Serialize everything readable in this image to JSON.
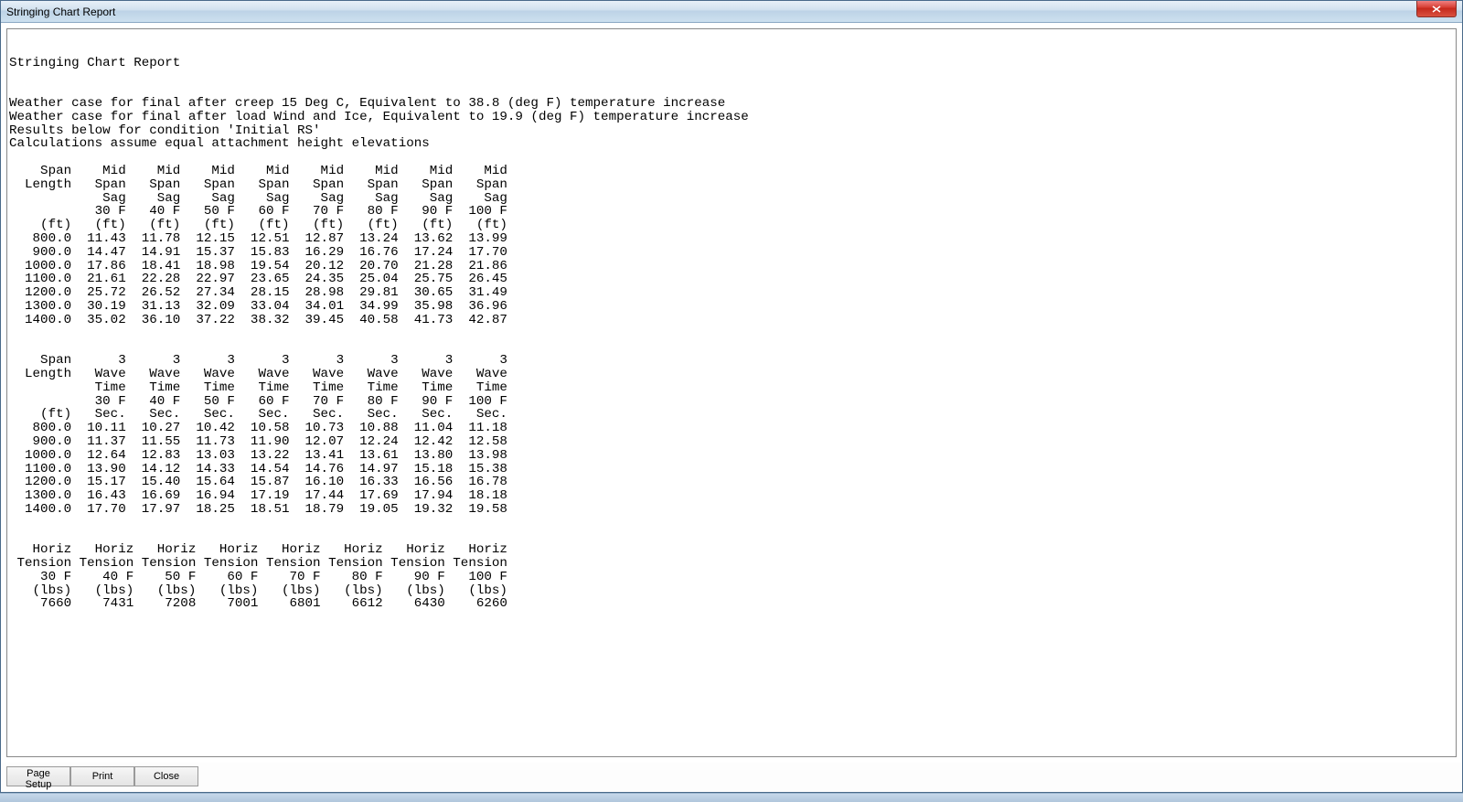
{
  "window": {
    "title": "Stringing Chart Report"
  },
  "buttons": {
    "page_setup": "Page Setup",
    "print": "Print",
    "close": "Close"
  },
  "report": {
    "title": "Stringing Chart Report",
    "notes": [
      "Weather case for final after creep 15 Deg C, Equivalent to 38.8 (deg F) temperature increase",
      "Weather case for final after load Wind and Ice, Equivalent to 19.9 (deg F) temperature increase",
      "Results below for condition 'Initial RS'",
      "Calculations assume equal attachment height elevations"
    ],
    "sag_table": {
      "header_lines": [
        "Span",
        "Length",
        "",
        "",
        "(ft)"
      ],
      "col_header_lines": [
        "Mid",
        "Span",
        "Sag"
      ],
      "temps": [
        "30 F",
        "40 F",
        "50 F",
        "60 F",
        "70 F",
        "80 F",
        "90 F",
        "100 F"
      ],
      "unit": "(ft)",
      "rows": [
        {
          "span": "800.0",
          "vals": [
            "11.43",
            "11.78",
            "12.15",
            "12.51",
            "12.87",
            "13.24",
            "13.62",
            "13.99"
          ]
        },
        {
          "span": "900.0",
          "vals": [
            "14.47",
            "14.91",
            "15.37",
            "15.83",
            "16.29",
            "16.76",
            "17.24",
            "17.70"
          ]
        },
        {
          "span": "1000.0",
          "vals": [
            "17.86",
            "18.41",
            "18.98",
            "19.54",
            "20.12",
            "20.70",
            "21.28",
            "21.86"
          ]
        },
        {
          "span": "1100.0",
          "vals": [
            "21.61",
            "22.28",
            "22.97",
            "23.65",
            "24.35",
            "25.04",
            "25.75",
            "26.45"
          ]
        },
        {
          "span": "1200.0",
          "vals": [
            "25.72",
            "26.52",
            "27.34",
            "28.15",
            "28.98",
            "29.81",
            "30.65",
            "31.49"
          ]
        },
        {
          "span": "1300.0",
          "vals": [
            "30.19",
            "31.13",
            "32.09",
            "33.04",
            "34.01",
            "34.99",
            "35.98",
            "36.96"
          ]
        },
        {
          "span": "1400.0",
          "vals": [
            "35.02",
            "36.10",
            "37.22",
            "38.32",
            "39.45",
            "40.58",
            "41.73",
            "42.87"
          ]
        }
      ]
    },
    "wave_table": {
      "header_lines": [
        "Span",
        "Length",
        "",
        "",
        "(ft)"
      ],
      "col_header_lines": [
        "3",
        "Wave",
        "Time"
      ],
      "temps": [
        "30 F",
        "40 F",
        "50 F",
        "60 F",
        "70 F",
        "80 F",
        "90 F",
        "100 F"
      ],
      "unit": "Sec.",
      "rows": [
        {
          "span": "800.0",
          "vals": [
            "10.11",
            "10.27",
            "10.42",
            "10.58",
            "10.73",
            "10.88",
            "11.04",
            "11.18"
          ]
        },
        {
          "span": "900.0",
          "vals": [
            "11.37",
            "11.55",
            "11.73",
            "11.90",
            "12.07",
            "12.24",
            "12.42",
            "12.58"
          ]
        },
        {
          "span": "1000.0",
          "vals": [
            "12.64",
            "12.83",
            "13.03",
            "13.22",
            "13.41",
            "13.61",
            "13.80",
            "13.98"
          ]
        },
        {
          "span": "1100.0",
          "vals": [
            "13.90",
            "14.12",
            "14.33",
            "14.54",
            "14.76",
            "14.97",
            "15.18",
            "15.38"
          ]
        },
        {
          "span": "1200.0",
          "vals": [
            "15.17",
            "15.40",
            "15.64",
            "15.87",
            "16.10",
            "16.33",
            "16.56",
            "16.78"
          ]
        },
        {
          "span": "1300.0",
          "vals": [
            "16.43",
            "16.69",
            "16.94",
            "17.19",
            "17.44",
            "17.69",
            "17.94",
            "18.18"
          ]
        },
        {
          "span": "1400.0",
          "vals": [
            "17.70",
            "17.97",
            "18.25",
            "18.51",
            "18.79",
            "19.05",
            "19.32",
            "19.58"
          ]
        }
      ]
    },
    "tension_table": {
      "col_header_lines": [
        "Horiz",
        "Tension"
      ],
      "temps": [
        "30 F",
        "40 F",
        "50 F",
        "60 F",
        "70 F",
        "80 F",
        "90 F",
        "100 F"
      ],
      "unit": "(lbs)",
      "vals": [
        "7660",
        "7431",
        "7208",
        "7001",
        "6801",
        "6612",
        "6430",
        "6260"
      ]
    }
  }
}
